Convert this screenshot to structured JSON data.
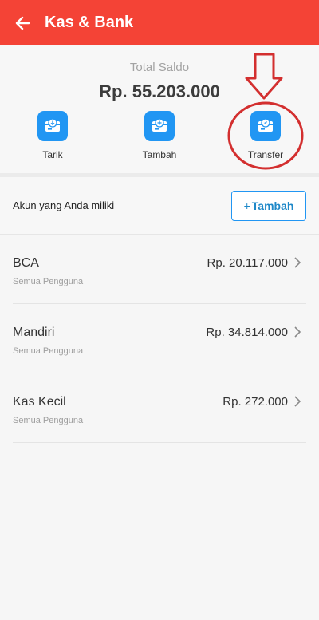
{
  "header": {
    "title": "Kas & Bank"
  },
  "summary": {
    "total_label": "Total Saldo",
    "total_value": "Rp. 55.203.000",
    "actions": [
      {
        "label": "Tarik",
        "icon": "withdraw-icon"
      },
      {
        "label": "Tambah",
        "icon": "add-money-icon"
      },
      {
        "label": "Transfer",
        "icon": "transfer-icon"
      }
    ]
  },
  "accounts": {
    "title": "Akun yang Anda miliki",
    "add_label": "Tambah",
    "items": [
      {
        "name": "BCA",
        "subtitle": "Semua Pengguna",
        "amount": "Rp. 20.117.000"
      },
      {
        "name": "Mandiri",
        "subtitle": "Semua Pengguna",
        "amount": "Rp. 34.814.000"
      },
      {
        "name": "Kas Kecil",
        "subtitle": "Semua Pengguna",
        "amount": "Rp. 272.000"
      }
    ]
  },
  "colors": {
    "app_bar": "#f44336",
    "accent": "#2196f3",
    "annotation": "#d32f2f"
  }
}
